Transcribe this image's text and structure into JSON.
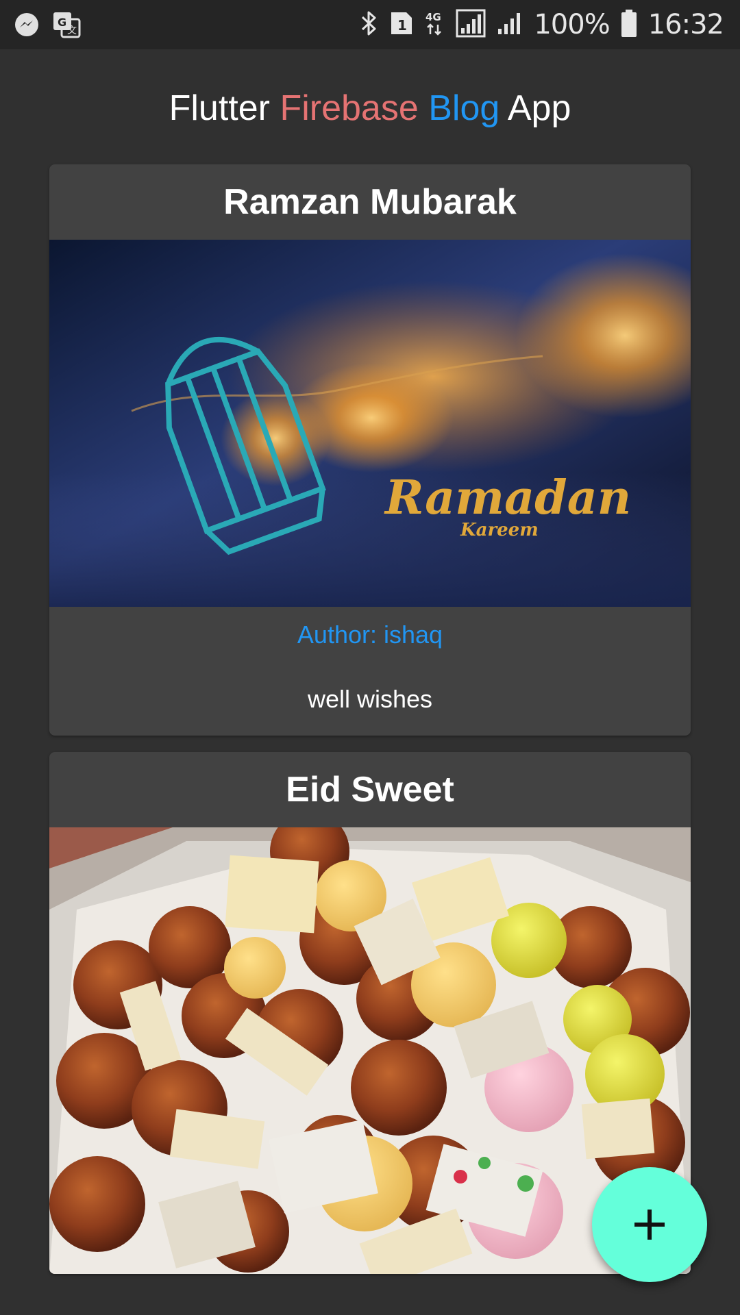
{
  "status_bar": {
    "left_icons": [
      "messenger-icon",
      "translate-icon"
    ],
    "right_icons": [
      "bluetooth-icon",
      "sim-1-icon",
      "4g-data-icon",
      "signal-icon",
      "signal-2-icon",
      "battery-icon"
    ],
    "battery": "100%",
    "time": "16:32"
  },
  "app_bar": {
    "title_parts": [
      "Flutter",
      "Firebase",
      "Blog",
      "App"
    ],
    "colors": {
      "firebase": "#e57373",
      "blog": "#2196f3",
      "base": "#ffffff"
    }
  },
  "posts": [
    {
      "title": "Ramzan Mubarak",
      "image_text": "Ramadan",
      "image_subtext": "Kareem",
      "author": "Author: ishaq",
      "description": "well wishes"
    },
    {
      "title": "Eid Sweet"
    }
  ],
  "fab": {
    "icon": "add-icon",
    "color": "#64ffda"
  },
  "colors": {
    "background": "#303030",
    "card": "#424242",
    "status_bar": "#252525"
  }
}
